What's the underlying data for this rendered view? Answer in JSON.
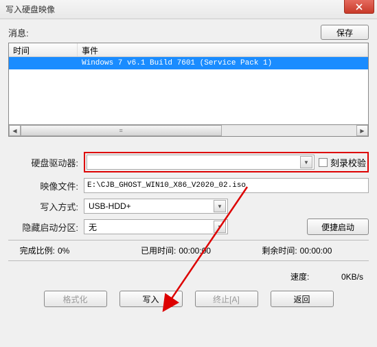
{
  "title": "写入硬盘映像",
  "msg_label": "消息:",
  "save_btn": "保存",
  "cols": {
    "time": "时间",
    "event": "事件"
  },
  "rows": [
    {
      "time": "",
      "event": "Windows 7 v6.1 Build 7601 (Service Pack 1)"
    }
  ],
  "form": {
    "drive_label": "硬盘驱动器:",
    "drive_value": "",
    "verify_label": "刻录校验",
    "image_label": "映像文件:",
    "image_value": "E:\\CJB_GHOST_WIN10_X86_V2020_02.iso",
    "write_mode_label": "写入方式:",
    "write_mode_value": "USB-HDD+",
    "hidden_label": "隐藏启动分区:",
    "hidden_value": "无",
    "quick_boot_btn": "便捷启动"
  },
  "progress": {
    "pct_label": "完成比例:",
    "pct_value": "0%",
    "elapsed_label": "已用时间:",
    "elapsed_value": "00:00:00",
    "remain_label": "剩余时间:",
    "remain_value": "00:00:00",
    "speed_label": "速度:",
    "speed_value": "0KB/s"
  },
  "buttons": {
    "format": "格式化",
    "write": "写入",
    "abort": "终止[A]",
    "back": "返回"
  }
}
